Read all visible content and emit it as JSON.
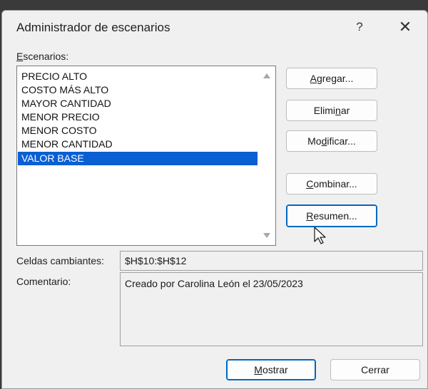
{
  "dialog": {
    "title": "Administrador de escenarios",
    "help_label": "?",
    "close_label": "✕"
  },
  "scenarios": {
    "label_first": "E",
    "label_rest": "scenarios:",
    "items": [
      "PRECIO ALTO",
      "COSTO MÁS ALTO",
      "MAYOR CANTIDAD",
      "MENOR PRECIO",
      "MENOR COSTO",
      "MENOR CANTIDAD",
      "VALOR BASE"
    ],
    "selected": "VALOR BASE"
  },
  "buttons": {
    "agregar": {
      "pre": "",
      "key": "A",
      "post": "gregar..."
    },
    "eliminar": {
      "pre": "Elimi",
      "key": "n",
      "post": "ar"
    },
    "modificar": {
      "pre": "Mo",
      "key": "d",
      "post": "ificar..."
    },
    "combinar": {
      "pre": "",
      "key": "C",
      "post": "ombinar..."
    },
    "resumen": {
      "pre": "",
      "key": "R",
      "post": "esumen..."
    },
    "mostrar": {
      "pre": "",
      "key": "M",
      "post": "ostrar"
    },
    "cerrar": {
      "label": "Cerrar"
    }
  },
  "details": {
    "changing_cells_label": "Celdas cambiantes:",
    "changing_cells_value": "$H$10:$H$12",
    "comment_label": "Comentario:",
    "comment_value": "Creado por Carolina León el 23/05/2023"
  }
}
